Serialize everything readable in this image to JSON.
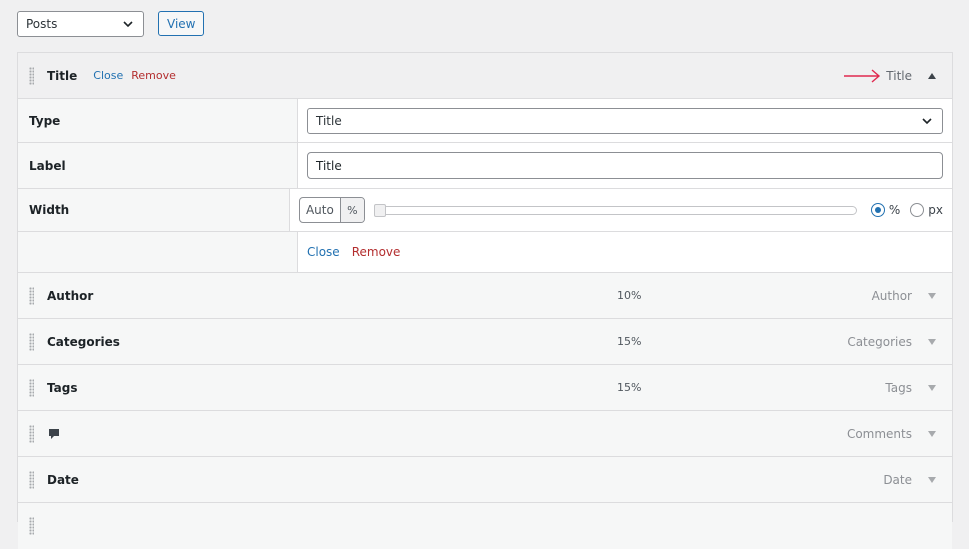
{
  "toolbar": {
    "post_type": "Posts",
    "view_label": "View"
  },
  "accent": "#2271b1",
  "remove_color": "#b32d2e",
  "open_column": {
    "title": "Title",
    "close": "Close",
    "remove": "Remove",
    "header_label": "Title",
    "fields": {
      "type_label": "Type",
      "type_value": "Title",
      "label_label": "Label",
      "label_value": "Title",
      "width_label": "Width",
      "width_value": "Auto",
      "width_unit": "%",
      "unit_options": [
        "%",
        "px"
      ],
      "selected_unit": "%"
    },
    "footer_close": "Close",
    "footer_remove": "Remove"
  },
  "columns": [
    {
      "title": "Author",
      "width": "10%",
      "label": "Author"
    },
    {
      "title": "Categories",
      "width": "15%",
      "label": "Categories"
    },
    {
      "title": "Tags",
      "width": "15%",
      "label": "Tags"
    },
    {
      "title": "",
      "icon": "comment-icon",
      "width": "",
      "label": "Comments"
    },
    {
      "title": "Date",
      "width": "",
      "label": "Date"
    }
  ]
}
